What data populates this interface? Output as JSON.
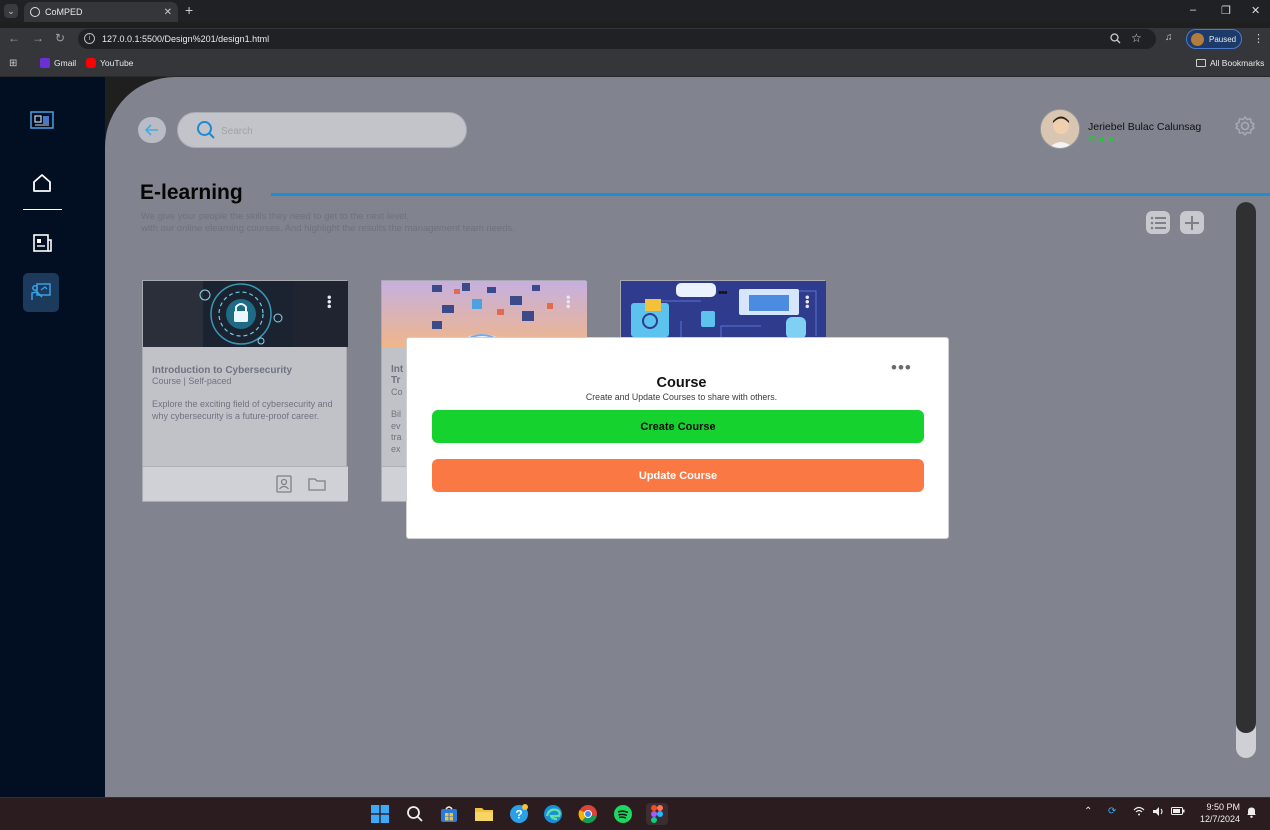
{
  "browser": {
    "tab_title": "CoMPED",
    "url": "127.0.0.1:5500/Design%201/design1.html",
    "profile_status": "Paused",
    "bookmarks": [
      {
        "label": "Gmail",
        "color": "#6b2fd6"
      },
      {
        "label": "YouTube",
        "color": "#ff0000"
      }
    ],
    "all_bookmarks": "All Bookmarks"
  },
  "header": {
    "search_placeholder": "Search",
    "user_name": "Jeriebel Bulac Calunsag",
    "user_role": "Student"
  },
  "page": {
    "title": "E-learning",
    "description_line1": "We give your people the skills they need to get to the next level,",
    "description_line2": "with our online elearning courses. And highlight the results the management team needs."
  },
  "courses": [
    {
      "title": "Introduction to Cybersecurity",
      "meta": "Course | Self-paced",
      "description": "Explore the exciting field of cybersecurity and why cybersecurity is a future-proof career."
    },
    {
      "title_fragment1": "Int",
      "title_fragment2": "Tr",
      "meta_fragment": "Co",
      "desc_fragments": [
        "Bil",
        "ev",
        "tra",
        "ex"
      ]
    },
    {}
  ],
  "modal": {
    "title": "Course",
    "subtitle": "Create and Update Courses to share with others.",
    "create_label": "Create Course",
    "update_label": "Update Course"
  },
  "taskbar": {
    "time": "9:50 PM",
    "date": "12/7/2024"
  },
  "colors": {
    "accent_line": "#1a8fd6",
    "create_button": "#16d22e",
    "update_button": "#fa7844",
    "student_status": "#17d330",
    "sidebar": "#020f22"
  }
}
